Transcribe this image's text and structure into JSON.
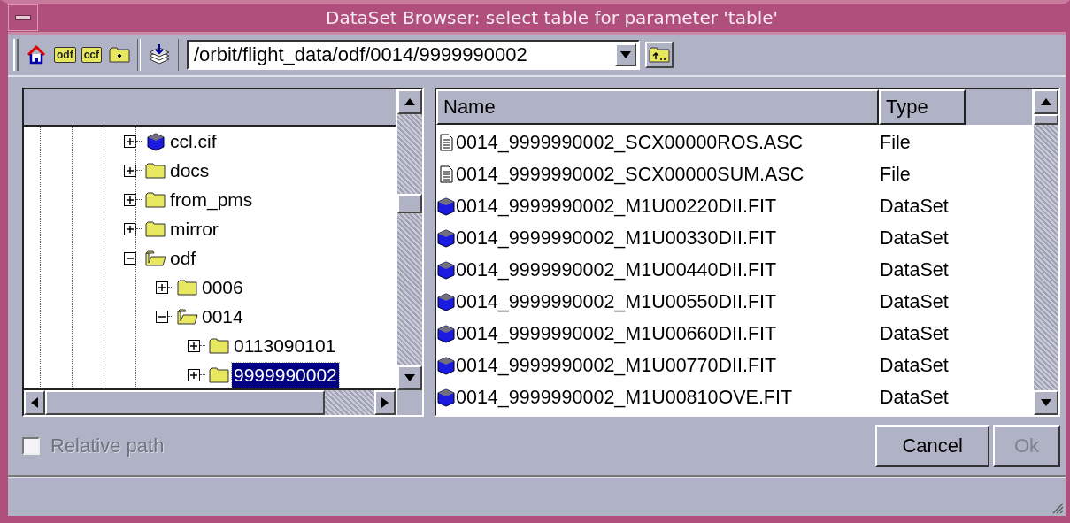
{
  "window": {
    "title": "DataSet Browser: select table for parameter 'table'"
  },
  "toolbar": {
    "buttons": [
      {
        "kind": "home"
      },
      {
        "kind": "folder",
        "label": "odf"
      },
      {
        "kind": "folder",
        "label": "ccf"
      },
      {
        "kind": "newfolder"
      },
      {
        "kind": "stack"
      }
    ],
    "path": {
      "value": "/orbit/flight_data/odf/0014/9999990002"
    }
  },
  "tree": {
    "items": [
      {
        "label": "ccl.cif",
        "kind": "dataset",
        "expanded": false,
        "selected": false
      },
      {
        "label": "docs",
        "kind": "folder",
        "expanded": false,
        "selected": false
      },
      {
        "label": "from_pms",
        "kind": "folder",
        "expanded": false,
        "selected": false
      },
      {
        "label": "mirror",
        "kind": "folder",
        "expanded": false,
        "selected": false
      },
      {
        "label": "odf",
        "kind": "folder",
        "expanded": true,
        "selected": false,
        "children": [
          {
            "label": "0006",
            "kind": "folder",
            "expanded": false,
            "selected": false
          },
          {
            "label": "0014",
            "kind": "folder",
            "expanded": true,
            "selected": false,
            "children": [
              {
                "label": "0113090101",
                "kind": "folder",
                "expanded": false,
                "selected": false
              },
              {
                "label": "9999990002",
                "kind": "folder",
                "expanded": false,
                "selected": true
              }
            ]
          }
        ]
      }
    ]
  },
  "table": {
    "columns": [
      "Name",
      "Type"
    ],
    "rows": [
      {
        "kind": "file",
        "name": "0014_9999990002_SCX00000ROS.ASC",
        "type": "File"
      },
      {
        "kind": "file",
        "name": "0014_9999990002_SCX00000SUM.ASC",
        "type": "File"
      },
      {
        "kind": "dataset",
        "name": "0014_9999990002_M1U00220DII.FIT",
        "type": "DataSet"
      },
      {
        "kind": "dataset",
        "name": "0014_9999990002_M1U00330DII.FIT",
        "type": "DataSet"
      },
      {
        "kind": "dataset",
        "name": "0014_9999990002_M1U00440DII.FIT",
        "type": "DataSet"
      },
      {
        "kind": "dataset",
        "name": "0014_9999990002_M1U00550DII.FIT",
        "type": "DataSet"
      },
      {
        "kind": "dataset",
        "name": "0014_9999990002_M1U00660DII.FIT",
        "type": "DataSet"
      },
      {
        "kind": "dataset",
        "name": "0014_9999990002_M1U00770DII.FIT",
        "type": "DataSet"
      },
      {
        "kind": "dataset",
        "name": "0014_9999990002_M1U00810OVE.FIT",
        "type": "DataSet"
      }
    ]
  },
  "relative_path": {
    "label": "Relative path",
    "checked": false,
    "disabled": true
  },
  "buttons": [
    {
      "label": "Cancel",
      "disabled": false
    },
    {
      "label": "Ok",
      "disabled": true
    }
  ]
}
